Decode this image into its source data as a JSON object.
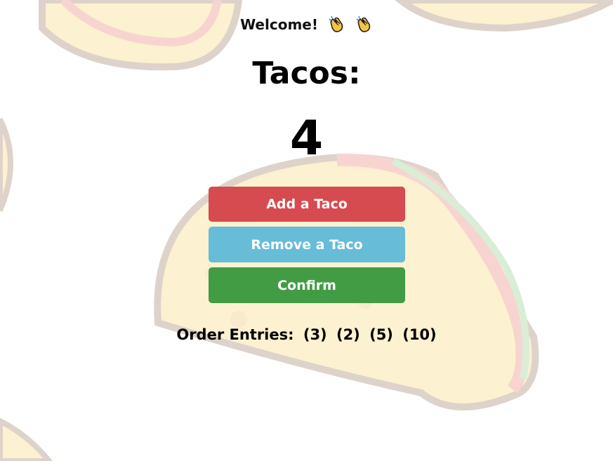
{
  "welcome": {
    "text": "Welcome!",
    "icons": [
      "clapping-hands-icon",
      "clapping-hands-icon"
    ]
  },
  "tacos": {
    "title": "Tacos:",
    "count": "4"
  },
  "buttons": {
    "add_label": "Add a Taco",
    "remove_label": "Remove a Taco",
    "confirm_label": "Confirm"
  },
  "orders": {
    "label": "Order Entries:",
    "entries": [
      "(3)",
      "(2)",
      "(5)",
      "(10)"
    ]
  },
  "colors": {
    "add": "#d64b4f",
    "remove": "#67bcd8",
    "confirm": "#429c44"
  }
}
